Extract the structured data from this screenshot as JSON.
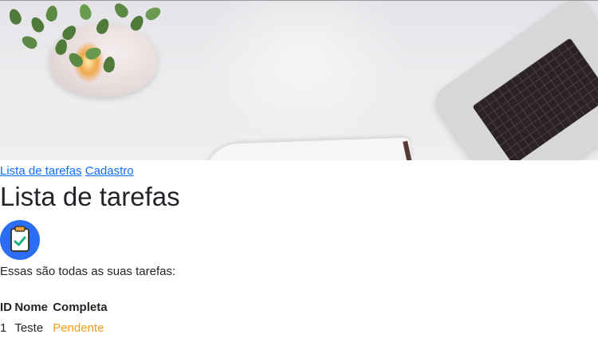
{
  "nav": {
    "links": [
      "Lista de tarefas",
      "Cadastro"
    ]
  },
  "page": {
    "title": "Lista de tarefas",
    "icon": "clipboard-check-icon",
    "description": "Essas são todas as suas tarefas:"
  },
  "table": {
    "headers": [
      "ID",
      "Nome",
      "Completa"
    ],
    "rows": [
      {
        "id": "1",
        "nome": "Teste",
        "completa": "Pendente"
      }
    ]
  },
  "colors": {
    "link": "#0d6efd",
    "pending": "#f0a020",
    "icon_bg": "#2b6df3"
  }
}
